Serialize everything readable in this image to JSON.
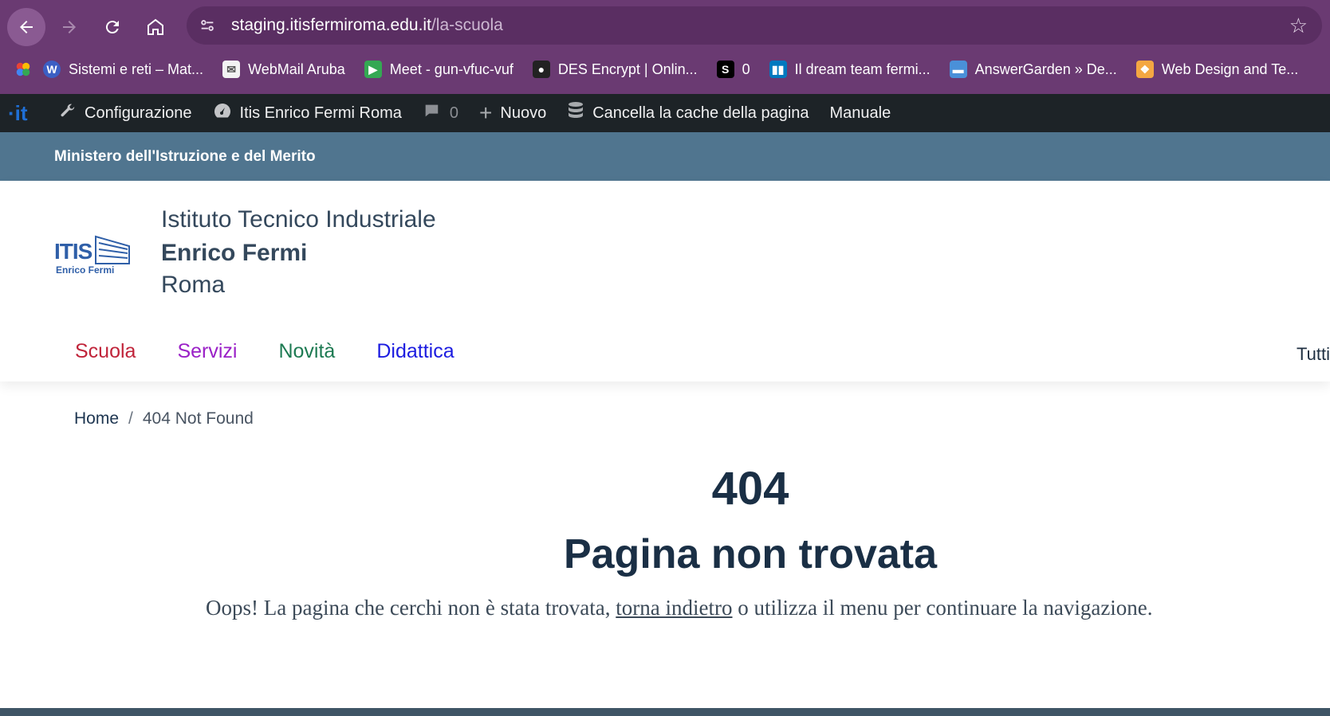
{
  "browser": {
    "url_host": "staging.itisfermiroma.edu.it",
    "url_path": "/la-scuola",
    "bookmarks": [
      {
        "label": "Sistemi e reti – Mat...",
        "icon": "wordpress-icon",
        "color": "#3b5fc4"
      },
      {
        "label": "WebMail Aruba",
        "icon": "mail-icon",
        "color": "#ffffff"
      },
      {
        "label": "Meet - gun-vfuc-vuf",
        "icon": "meet-icon",
        "color": "#34a853"
      },
      {
        "label": "DES Encrypt | Onlin...",
        "icon": "des-icon",
        "color": "#222222"
      },
      {
        "label": "0",
        "icon": "s-icon",
        "color": "#000000"
      },
      {
        "label": "Il dream team fermi...",
        "icon": "trello-icon",
        "color": "#0079bf"
      },
      {
        "label": "AnswerGarden » De...",
        "icon": "chat-icon",
        "color": "#4a90d9"
      },
      {
        "label": "Web Design and Te...",
        "icon": "book-icon",
        "color": "#f4a742"
      }
    ]
  },
  "adminbar": {
    "logo": "it",
    "items": [
      "Configurazione",
      "Itis Enrico Fermi Roma",
      "0",
      "Nuovo",
      "Cancella la cache della pagina",
      "Manuale"
    ]
  },
  "ministry": "Ministero dell'Istruzione e del Merito",
  "school": {
    "type": "Istituto Tecnico Industriale",
    "name": "Enrico Fermi",
    "city": "Roma",
    "logo_text": "ITIS",
    "logo_sub": "Enrico Fermi"
  },
  "menu": [
    {
      "label": "Scuola",
      "color": "#c0243a"
    },
    {
      "label": "Servizi",
      "color": "#9a20c7"
    },
    {
      "label": "Novità",
      "color": "#1d7a52"
    },
    {
      "label": "Didattica",
      "color": "#1c1ce0"
    }
  ],
  "menu_all": "Tutti",
  "breadcrumb": {
    "home": "Home",
    "current": "404 Not Found"
  },
  "error": {
    "code": "404",
    "title": "Pagina non trovata",
    "msg_before": "Oops! La pagina che cerchi non è stata trovata, ",
    "msg_link": "torna indietro",
    "msg_after": " o utilizza il menu per continuare la navigazione."
  }
}
